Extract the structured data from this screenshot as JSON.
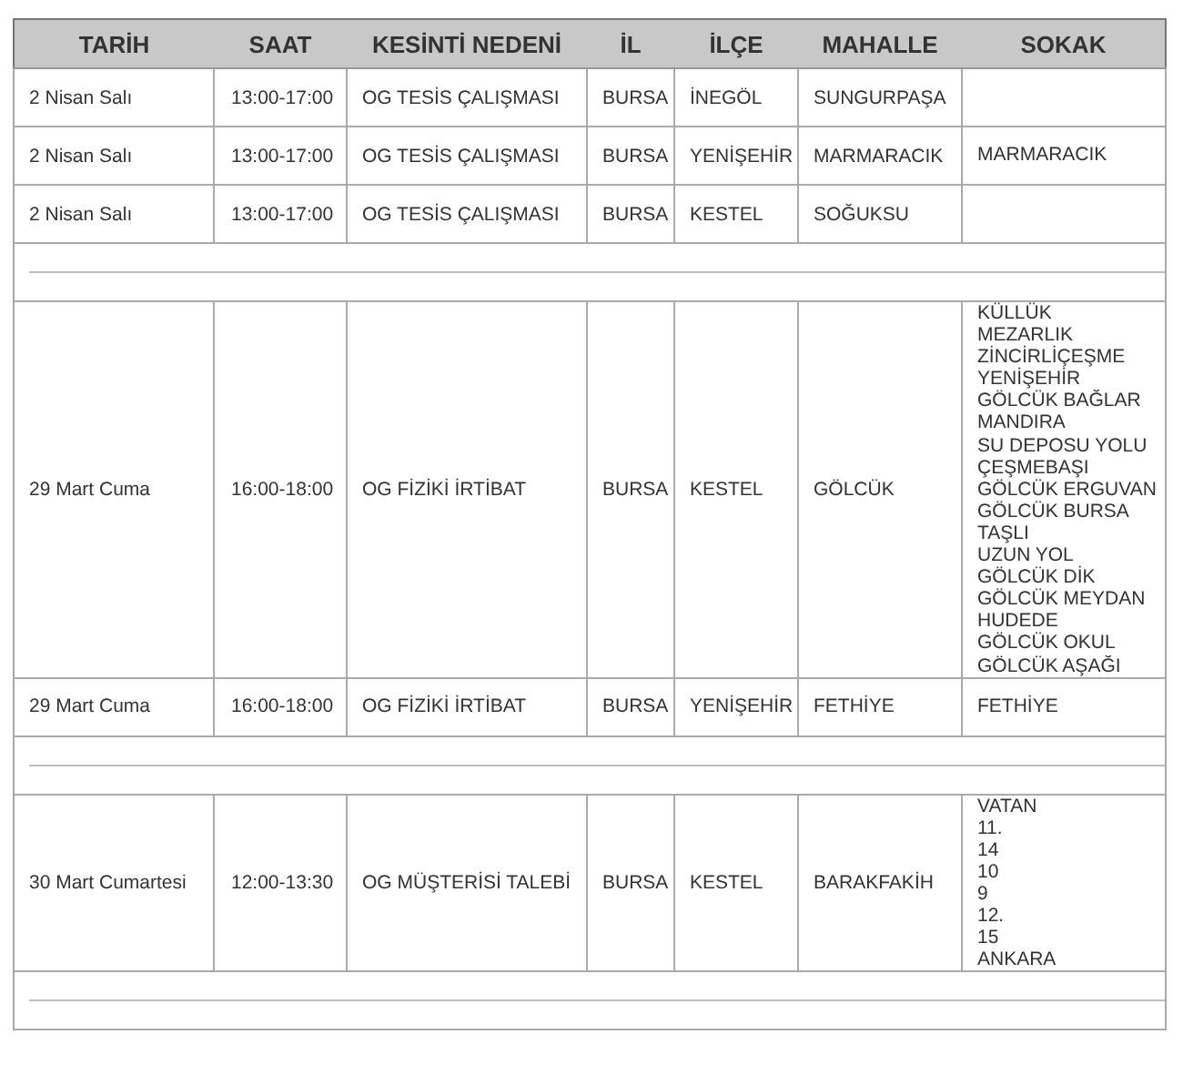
{
  "table": {
    "columns": [
      "TARİH",
      "SAAT",
      "KESİNTİ NEDENİ",
      "İL",
      "İLÇE",
      "MAHALLE",
      "SOKAK"
    ],
    "rows": [
      {
        "kind": "data",
        "tarih": "2 Nisan Salı",
        "saat": "13:00-17:00",
        "neden": "OG TESİS ÇALIŞMASI",
        "il": "BURSA",
        "ilce": "İNEGÖL",
        "mahalle": "SUNGURPAŞA",
        "sokak": []
      },
      {
        "kind": "data",
        "tarih": "2 Nisan Salı",
        "saat": "13:00-17:00",
        "neden": "OG TESİS ÇALIŞMASI",
        "il": "BURSA",
        "ilce": "YENİŞEHİR",
        "mahalle": "MARMARACIK",
        "sokak": [
          "MARMARACIK"
        ]
      },
      {
        "kind": "data",
        "tarih": "2 Nisan Salı",
        "saat": "13:00-17:00",
        "neden": "OG TESİS ÇALIŞMASI",
        "il": "BURSA",
        "ilce": "KESTEL",
        "mahalle": "SOĞUKSU",
        "sokak": []
      },
      {
        "kind": "spacer"
      },
      {
        "kind": "data",
        "tarih": "29 Mart Cuma",
        "saat": "16:00-18:00",
        "neden": "OG FİZİKİ İRTİBAT",
        "il": "BURSA",
        "ilce": "KESTEL",
        "mahalle": "GÖLCÜK",
        "sokak": [
          "KÜLLÜK",
          "MEZARLIK",
          "ZİNCİRLİÇEŞME",
          "YENİŞEHİR",
          "GÖLCÜK BAĞLAR",
          "MANDIRA",
          "SU DEPOSU YOLU",
          "ÇEŞMEBAŞI",
          "GÖLCÜK ERGUVAN",
          "GÖLCÜK BURSA",
          "TAŞLI",
          "UZUN YOL",
          "GÖLCÜK DİK",
          "GÖLCÜK MEYDAN",
          "HUDEDE",
          "GÖLCÜK OKUL",
          "GÖLCÜK AŞAĞI"
        ]
      },
      {
        "kind": "data",
        "tarih": "29 Mart Cuma",
        "saat": "16:00-18:00",
        "neden": "OG FİZİKİ İRTİBAT",
        "il": "BURSA",
        "ilce": "YENİŞEHİR",
        "mahalle": "FETHİYE",
        "sokak": [
          "FETHİYE"
        ]
      },
      {
        "kind": "spacer"
      },
      {
        "kind": "data",
        "tarih": "30 Mart Cumartesi",
        "saat": "12:00-13:30",
        "neden": "OG MÜŞTERİSİ TALEBİ",
        "il": "BURSA",
        "ilce": "KESTEL",
        "mahalle": "BARAKFAKİH",
        "sokak": [
          "VATAN",
          "11.",
          "14",
          "10",
          "9",
          "12.",
          "15",
          "ANKARA"
        ]
      },
      {
        "kind": "spacer"
      }
    ]
  }
}
